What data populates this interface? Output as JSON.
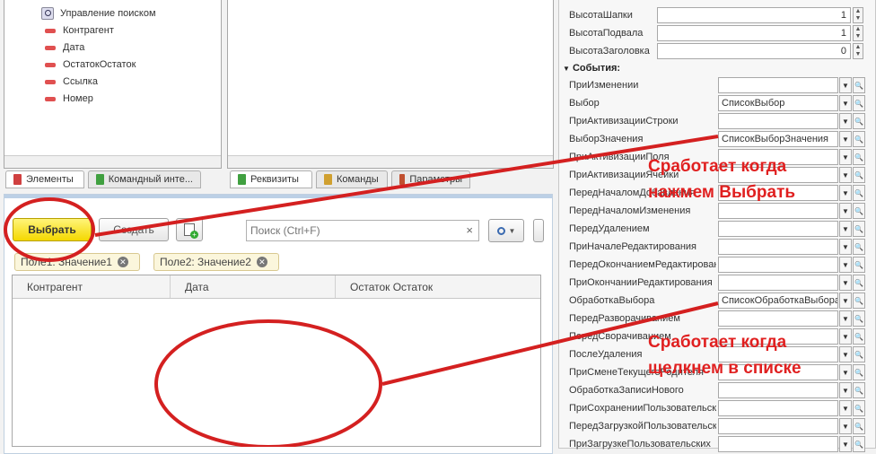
{
  "tree": {
    "items": [
      {
        "label": "Управление поиском",
        "icon": "search-icon"
      },
      {
        "label": "Контрагент",
        "icon": "attribute-icon"
      },
      {
        "label": "Дата",
        "icon": "attribute-icon"
      },
      {
        "label": "ОстатокОстаток",
        "icon": "attribute-icon"
      },
      {
        "label": "Ссылка",
        "icon": "attribute-icon"
      },
      {
        "label": "Номер",
        "icon": "attribute-icon"
      }
    ]
  },
  "left_tabs": [
    {
      "label": "Элементы",
      "color": "#d04040"
    },
    {
      "label": "Командный инте...",
      "color": "#40a040"
    }
  ],
  "mid_tabs": [
    {
      "label": "Реквизиты",
      "color": "#40a040"
    },
    {
      "label": "Команды",
      "color": "#d0a030"
    },
    {
      "label": "Параметры",
      "color": "#c05030"
    }
  ],
  "form": {
    "select_label": "Выбрать",
    "create_label": "Создать",
    "search_placeholder": "Поиск (Ctrl+F)",
    "chips": [
      {
        "label": "Поле1:  Значение1"
      },
      {
        "label": "Поле2:  Значение2"
      }
    ],
    "columns": [
      "Контрагент",
      "Дата",
      "Остаток Остаток"
    ]
  },
  "props": {
    "sizes": [
      {
        "label": "ВысотаШапки",
        "value": "1"
      },
      {
        "label": "ВысотаПодвала",
        "value": "1"
      },
      {
        "label": "ВысотаЗаголовка",
        "value": "0"
      }
    ],
    "events_header": "События:",
    "events": [
      {
        "label": "ПриИзменении",
        "value": ""
      },
      {
        "label": "Выбор",
        "value": "СписокВыбор"
      },
      {
        "label": "ПриАктивизацииСтроки",
        "value": ""
      },
      {
        "label": "ВыборЗначения",
        "value": "СписокВыборЗначения"
      },
      {
        "label": "ПриАктивизацииПоля",
        "value": ""
      },
      {
        "label": "ПриАктивизацииЯчейки",
        "value": ""
      },
      {
        "label": "ПередНачаломДобавления",
        "value": ""
      },
      {
        "label": "ПередНачаломИзменения",
        "value": ""
      },
      {
        "label": "ПередУдалением",
        "value": ""
      },
      {
        "label": "ПриНачалеРедактирования",
        "value": ""
      },
      {
        "label": "ПередОкончаниемРедактирования",
        "value": ""
      },
      {
        "label": "ПриОкончанииРедактирования",
        "value": ""
      },
      {
        "label": "ОбработкаВыбора",
        "value": "СписокОбработкаВыбора"
      },
      {
        "label": "ПередРазворачиванием",
        "value": ""
      },
      {
        "label": "ПередСворачиванием",
        "value": ""
      },
      {
        "label": "ПослеУдаления",
        "value": ""
      },
      {
        "label": "ПриСменеТекущегоРодителя",
        "value": ""
      },
      {
        "label": "ОбработкаЗаписиНового",
        "value": ""
      },
      {
        "label": "ПриСохраненииПользовательских",
        "value": ""
      },
      {
        "label": "ПередЗагрузкойПользовательских",
        "value": ""
      },
      {
        "label": "ПриЗагрузкеПользовательских",
        "value": ""
      }
    ]
  },
  "annotations": {
    "select_note": [
      "Сработает когда",
      "нажмем Выбрать"
    ],
    "list_note": [
      "Сработает когда",
      "щелкнем в списке"
    ],
    "color": "#e02020"
  }
}
